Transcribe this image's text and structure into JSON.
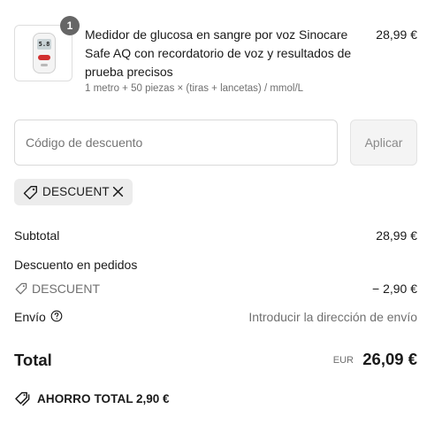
{
  "product": {
    "quantity": "1",
    "title": "Medidor de glucosa en sangre por voz Sinocare Safe AQ con recordatorio de voz y resultados de prueba precisos",
    "variant": "1 metro + 50 piezas × (tiras + lancetas) / mmol/L",
    "price": "28,99 €",
    "screen_reading": "5.8"
  },
  "discount": {
    "placeholder": "Código de descuento",
    "apply_label": "Aplicar",
    "applied_code": "DESCUENT"
  },
  "summary": {
    "subtotal_label": "Subtotal",
    "subtotal_value": "28,99 €",
    "order_discount_label": "Descuento en pedidos",
    "discount_code": "DESCUENT",
    "discount_value": "− 2,90 €",
    "shipping_label": "Envío",
    "shipping_value": "Introducir la dirección de envío",
    "total_label": "Total",
    "currency": "EUR",
    "total_value": "26,09 €",
    "savings_label": "AHORRO TOTAL",
    "savings_value": "2,90 €"
  },
  "icons": {
    "tag": "tag-icon",
    "close": "close-icon",
    "info": "info-icon",
    "savings": "double-tag-icon"
  },
  "colors": {
    "badge": "#666666",
    "chip_bg": "#ececec",
    "muted_text": "#707070",
    "device_button": "#d12f2f"
  }
}
